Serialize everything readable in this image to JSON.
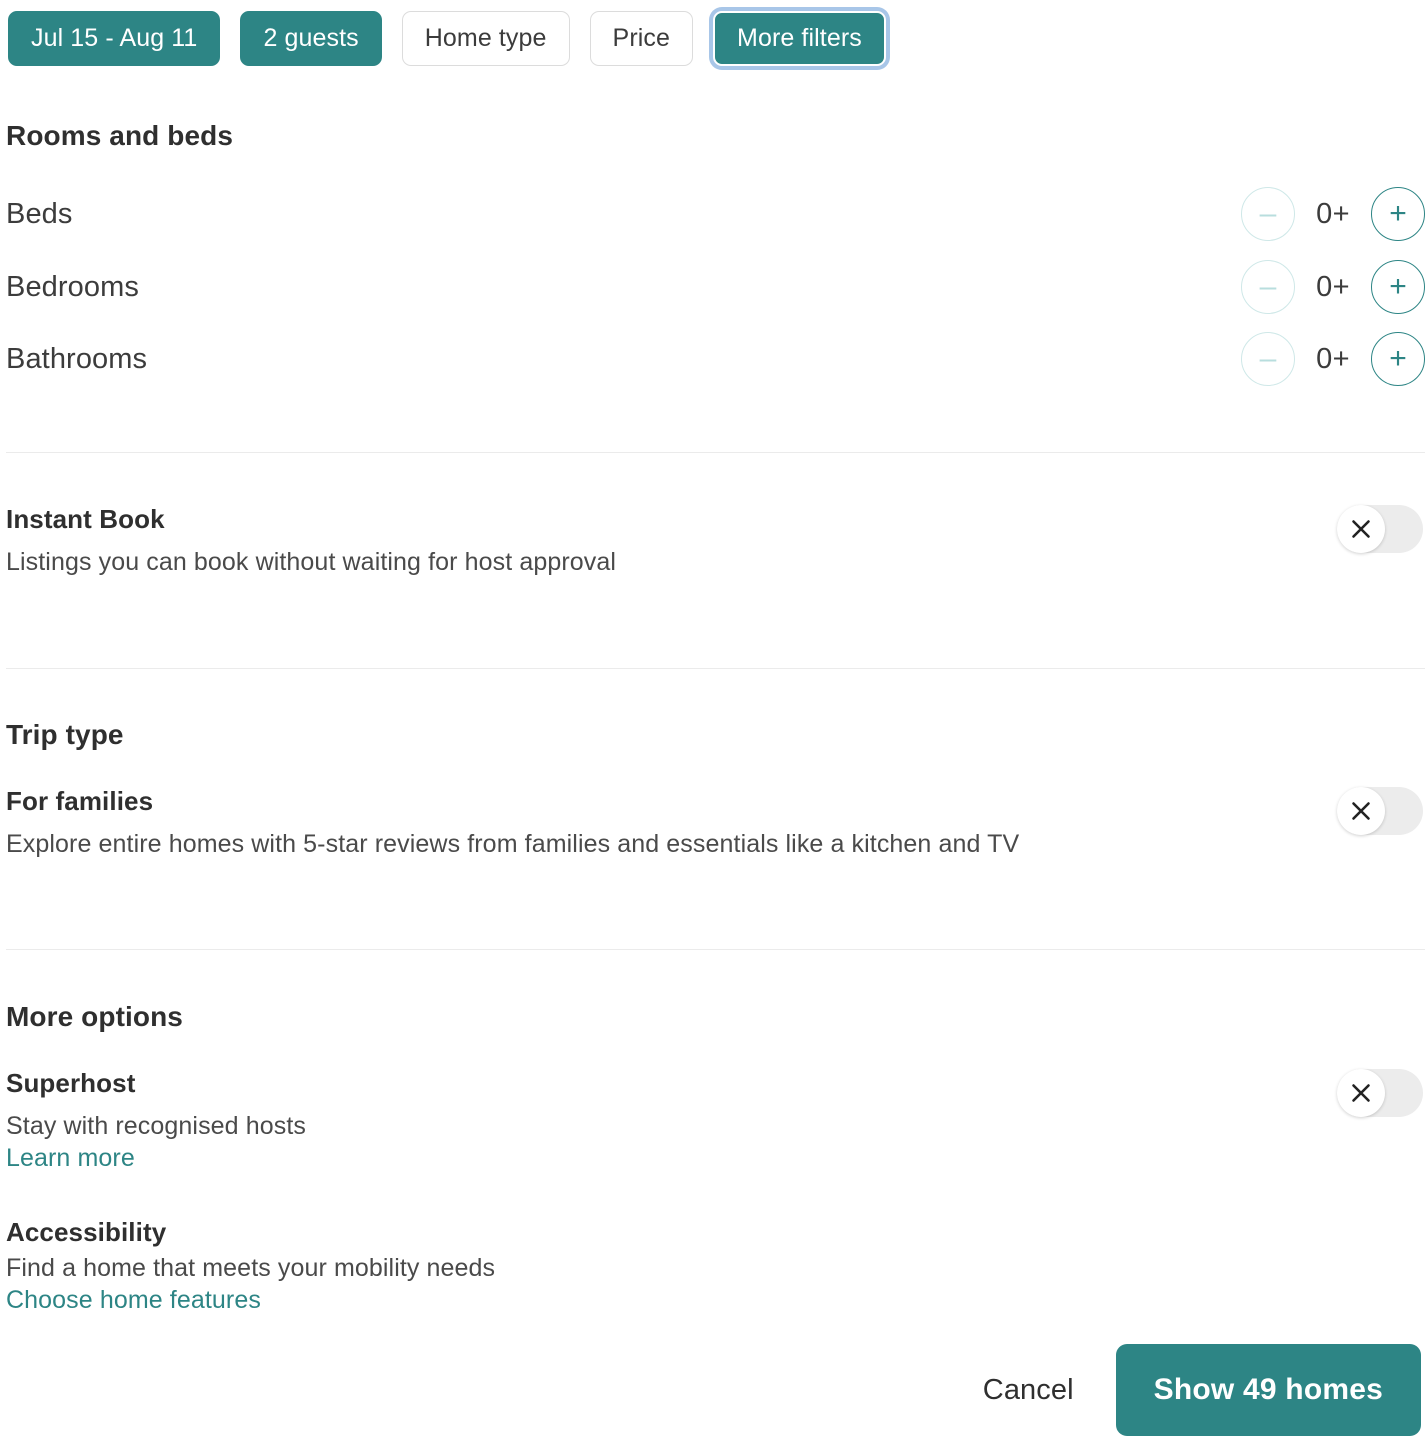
{
  "filter_bar": {
    "pills": [
      {
        "label": "Jul 15 - Aug 11",
        "style": "filled",
        "name": "filter-pill-dates"
      },
      {
        "label": "2 guests",
        "style": "filled",
        "name": "filter-pill-guests"
      },
      {
        "label": "Home type",
        "style": "outline",
        "name": "filter-pill-home-type"
      },
      {
        "label": "Price",
        "style": "outline",
        "name": "filter-pill-price"
      },
      {
        "label": "More filters",
        "style": "focused",
        "name": "filter-pill-more-filters"
      }
    ]
  },
  "rooms_and_beds": {
    "title": "Rooms and beds",
    "rows": [
      {
        "label": "Beds",
        "value": "0+",
        "minus": "–",
        "plus": "+"
      },
      {
        "label": "Bedrooms",
        "value": "0+",
        "minus": "–",
        "plus": "+"
      },
      {
        "label": "Bathrooms",
        "value": "0+",
        "minus": "–",
        "plus": "+"
      }
    ]
  },
  "instant_book": {
    "title": "Instant Book",
    "description": "Listings you can book without waiting for host approval",
    "toggle_state": "off"
  },
  "trip_type": {
    "title": "Trip type",
    "for_families": {
      "title": "For families",
      "description": "Explore entire homes with 5-star reviews from families and essentials like a kitchen and TV",
      "toggle_state": "off"
    }
  },
  "more_options": {
    "title": "More options",
    "superhost": {
      "title": "Superhost",
      "description": "Stay with recognised hosts",
      "link": "Learn more",
      "toggle_state": "off"
    },
    "accessibility": {
      "title": "Accessibility",
      "description": "Find a home that meets your mobility needs",
      "link": "Choose home features"
    }
  },
  "footer": {
    "cancel_label": "Cancel",
    "submit_label": "Show 49 homes"
  },
  "colors": {
    "accent_teal": "#2d8585",
    "disabled_teal": "#cfe8e8",
    "focus_ring": "#a8c6e8",
    "toggle_track": "#ececec",
    "divider": "#ebebeb"
  }
}
